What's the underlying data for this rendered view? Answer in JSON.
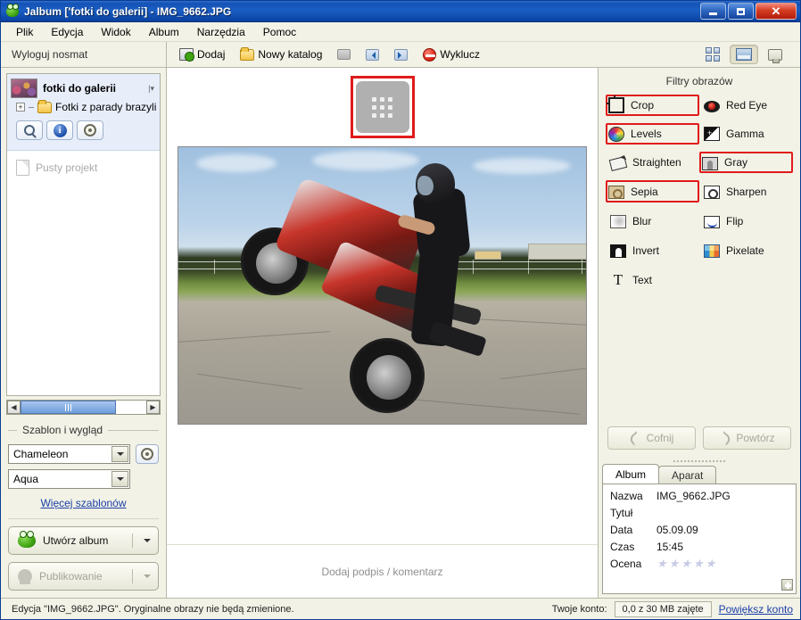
{
  "window": {
    "title": "Jalbum ['fotki do galerii] - IMG_9662.JPG",
    "minimize_label": "",
    "maximize_label": "",
    "close_label": "✕"
  },
  "menubar": {
    "items": [
      {
        "label": "Plik"
      },
      {
        "label": "Edycja"
      },
      {
        "label": "Widok"
      },
      {
        "label": "Album"
      },
      {
        "label": "Narzędzia"
      },
      {
        "label": "Pomoc"
      }
    ]
  },
  "toolbar": {
    "account_status": "Wyloguj nosmat",
    "add_label": "Dodaj",
    "new_folder_label": "Nowy katalog",
    "exclude_label": "Wyklucz",
    "view_buttons": [
      {
        "name": "grid-view",
        "selected": false
      },
      {
        "name": "single-view",
        "selected": true
      },
      {
        "name": "panel-view",
        "selected": false
      }
    ]
  },
  "sidebar": {
    "project": {
      "name": "fotki do galerii",
      "child": "Fotki z parady brazylijski"
    },
    "action_buttons": [
      {
        "name": "search-icon"
      },
      {
        "name": "info-icon"
      },
      {
        "name": "settings-icon"
      }
    ],
    "empty_project_label": "Pusty projekt",
    "template_section": {
      "title": "Szablon i wygląd",
      "skin": "Chameleon",
      "style": "Aqua",
      "more_templates_link": "Więcej szablonów"
    },
    "make_album_label": "Utwórz album",
    "publish_label": "Publikowanie"
  },
  "center": {
    "grid_tile_name": "grid-thumbnail-tile",
    "caption_placeholder": "Dodaj podpis / komentarz"
  },
  "filters": {
    "title": "Filtry obrazów",
    "items": [
      {
        "label": "Crop",
        "icon": "crop-icon",
        "highlighted": true
      },
      {
        "label": "Red Eye",
        "icon": "red-eye-icon",
        "highlighted": false
      },
      {
        "label": "Levels",
        "icon": "levels-icon",
        "highlighted": true
      },
      {
        "label": "Gamma",
        "icon": "gamma-icon",
        "highlighted": false
      },
      {
        "label": "Straighten",
        "icon": "straighten-icon",
        "highlighted": false
      },
      {
        "label": "Gray",
        "icon": "gray-icon",
        "highlighted": true
      },
      {
        "label": "Sepia",
        "icon": "sepia-icon",
        "highlighted": true
      },
      {
        "label": "Sharpen",
        "icon": "sharpen-icon",
        "highlighted": false
      },
      {
        "label": "Blur",
        "icon": "blur-icon",
        "highlighted": false
      },
      {
        "label": "Flip",
        "icon": "flip-icon",
        "highlighted": false
      },
      {
        "label": "Invert",
        "icon": "invert-icon",
        "highlighted": false
      },
      {
        "label": "Pixelate",
        "icon": "pixelate-icon",
        "highlighted": false
      },
      {
        "label": "Text",
        "icon": "text-icon",
        "highlighted": false
      }
    ],
    "undo_label": "Cofnij",
    "redo_label": "Powtórz"
  },
  "info_panel": {
    "tabs": [
      {
        "label": "Album",
        "active": true
      },
      {
        "label": "Aparat",
        "active": false
      }
    ],
    "fields": [
      {
        "key": "Nazwa",
        "value": "IMG_9662.JPG"
      },
      {
        "key": "Tytuł",
        "value": ""
      },
      {
        "key": "Data",
        "value": "05.09.09"
      },
      {
        "key": "Czas",
        "value": "15:45"
      }
    ],
    "rating_label": "Ocena",
    "rating_stars": 5,
    "rating_filled": 0
  },
  "statusbar": {
    "message": "Edycja \"IMG_9662.JPG\". Oryginalne obrazy nie będą zmienione.",
    "account_label": "Twoje konto:",
    "quota": "0,0 z 30 MB zajęte",
    "upgrade_link": "Powiększ konto"
  },
  "colors": {
    "titlebar": "#1552b5",
    "panel_bg": "#f2f2e6",
    "highlight_red": "#e01b1b",
    "link_blue": "#1b3fa8",
    "selection_blue": "#e7eefa"
  }
}
